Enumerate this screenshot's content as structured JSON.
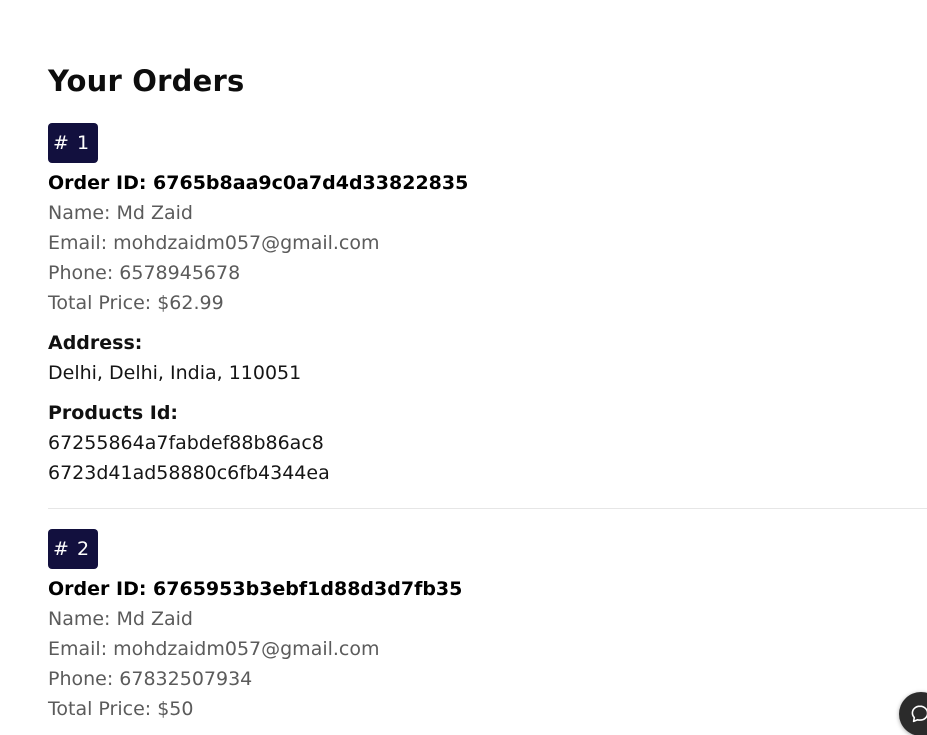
{
  "page": {
    "title": "Your Orders"
  },
  "labels": {
    "address_heading": "Address:",
    "products_heading": "Products Id:"
  },
  "orders": [
    {
      "badge": "# 1",
      "order_id": "Order ID: 6765b8aa9c0a7d4d33822835",
      "name": "Name: Md Zaid",
      "email": "Email: mohdzaidm057@gmail.com",
      "phone": "Phone: 6578945678",
      "total_price": "Total Price: $62.99",
      "address": "Delhi, Delhi, India, 110051",
      "product_ids": [
        "67255864a7fabdef88b86ac8",
        "6723d41ad58880c6fb4344ea"
      ]
    },
    {
      "badge": "# 2",
      "order_id": "Order ID: 6765953b3ebf1d88d3d7fb35",
      "name": "Name: Md Zaid",
      "email": "Email: mohdzaidm057@gmail.com",
      "phone": "Phone: 67832507934",
      "total_price": "Total Price: $50"
    }
  ],
  "icons": {
    "chat_button": "chat-bubble-icon"
  }
}
